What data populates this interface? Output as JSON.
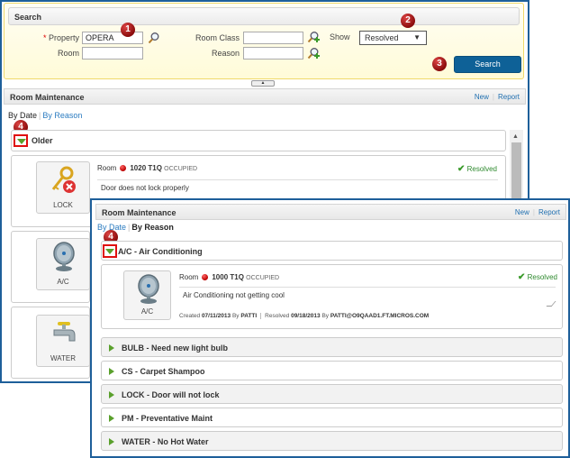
{
  "search": {
    "title": "Search",
    "property_label": "Property",
    "required_mark": "*",
    "property_value": "OPERA",
    "room_label": "Room",
    "room_value": "",
    "room_class_label": "Room Class",
    "room_class_value": "",
    "reason_label": "Reason",
    "reason_value": "",
    "show_label": "Show",
    "show_value": "Resolved",
    "search_button": "Search"
  },
  "callouts": [
    "1",
    "2",
    "3",
    "4"
  ],
  "back_panel": {
    "title": "Room Maintenance",
    "links": [
      "New",
      "Report"
    ],
    "tabs": [
      {
        "label": "By Date",
        "active": true
      },
      {
        "label": "By Reason",
        "active": false
      }
    ],
    "group": "Older",
    "items": [
      {
        "icon_label": "LOCK",
        "room_label": "Room",
        "room_number": "1020 T1Q",
        "room_status": "OCCUPIED",
        "status": "Resolved",
        "description": "Door does not lock properly"
      },
      {
        "icon_label": "A/C"
      },
      {
        "icon_label": "WATER"
      }
    ]
  },
  "front_panel": {
    "title": "Room Maintenance",
    "links": [
      "New",
      "Report"
    ],
    "tabs": [
      {
        "label": "By Date",
        "active": false
      },
      {
        "label": "By Reason",
        "active": true
      }
    ],
    "expanded_group": "A/C - Air Conditioning",
    "item": {
      "icon_label": "A/C",
      "room_label": "Room",
      "room_number": "1000 T1Q",
      "room_status": "OCCUPIED",
      "status": "Resolved",
      "description": "Air Conditioning not getting cool",
      "created_label": "Created",
      "created_date": "07/11/2013",
      "created_by_label": "By",
      "created_by": "PATTI",
      "resolved_label": "Resolved",
      "resolved_date": "09/18/2013",
      "resolved_by_label": "By",
      "resolved_by": "PATTI@O9QAAD1.FT.MICROS.COM"
    },
    "groups": [
      "BULB - Need new light bulb",
      "CS - Carpet Shampoo",
      "LOCK - Door will not lock",
      "PM - Preventative Maint",
      "WATER - No Hot Water"
    ]
  }
}
